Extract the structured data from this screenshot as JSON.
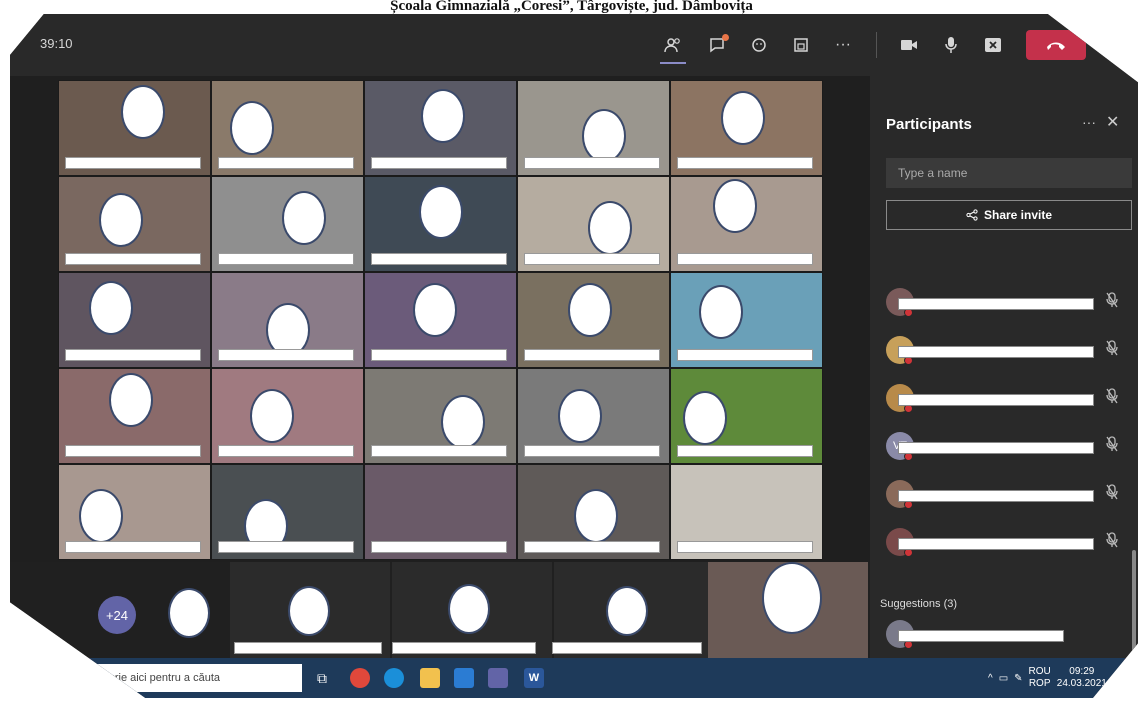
{
  "caption": "Școala Gimnazială „Coresi”, Târgoviște, jud. Dâmbovița",
  "meeting": {
    "timer": "39:10",
    "overflow_count": "+24"
  },
  "toolbar": {
    "people_icon": "people-icon",
    "chat_icon": "chat-icon",
    "reactions_icon": "reactions-icon",
    "share_icon": "share-tray-icon",
    "more_label": "···",
    "camera_icon": "camera-icon",
    "mic_icon": "mic-icon",
    "share_screen_icon": "share-screen-icon",
    "leave_icon": "hangup-icon"
  },
  "panel": {
    "title": "Participants",
    "more_label": "···",
    "close_label": "✕",
    "search_placeholder": "Type a name",
    "share_invite_label": "Share invite",
    "avatars": [
      "",
      "",
      "",
      "VT",
      "",
      ""
    ],
    "suggestions_label": "Suggestions (3)"
  },
  "taskbar": {
    "search_text": "Scrie aici pentru a căuta",
    "tray_lang_top": "ROU",
    "tray_lang_bottom": "ROP",
    "tray_time": "09:29",
    "tray_date": "24.03.2021"
  },
  "colors": {
    "accent": "#6264a7",
    "leave": "#c4314b",
    "panel_bg": "#292929",
    "status_red": "#d13438"
  }
}
